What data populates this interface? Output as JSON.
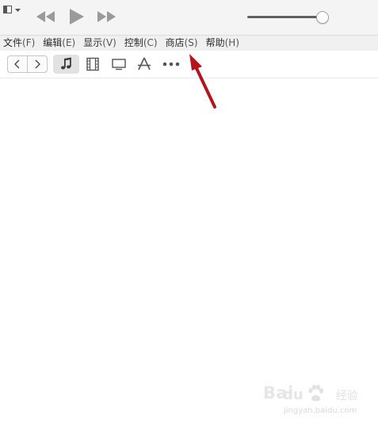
{
  "menubar": {
    "items": [
      {
        "label": "文件",
        "mnemonic": "(F)"
      },
      {
        "label": "编辑",
        "mnemonic": "(E)"
      },
      {
        "label": "显示",
        "mnemonic": "(V)"
      },
      {
        "label": "控制",
        "mnemonic": "(C)"
      },
      {
        "label": "商店",
        "mnemonic": "(S)"
      },
      {
        "label": "帮助",
        "mnemonic": "(H)"
      }
    ]
  },
  "playback": {
    "volume_level": 0.95
  },
  "toolbar": {
    "selected_media": "music",
    "media_icons": [
      "music-note-icon",
      "film-icon",
      "tv-icon",
      "app-store-icon",
      "more-icon"
    ]
  },
  "annotation": {
    "arrow_color": "#b3151d",
    "points_to": "store-menu"
  },
  "watermark": {
    "brand_latin": "Bai",
    "brand_latin_suffix": "du",
    "brand_cn": "经验",
    "url": "jingyan.baidu.com"
  },
  "colors": {
    "titlebar_bg": "#f4f4f4",
    "menubar_bg": "#f0f0f0",
    "icon_gray": "#8f8f8f",
    "icon_dark": "#4a4a4a",
    "selected_bg": "#e2e2e2"
  }
}
